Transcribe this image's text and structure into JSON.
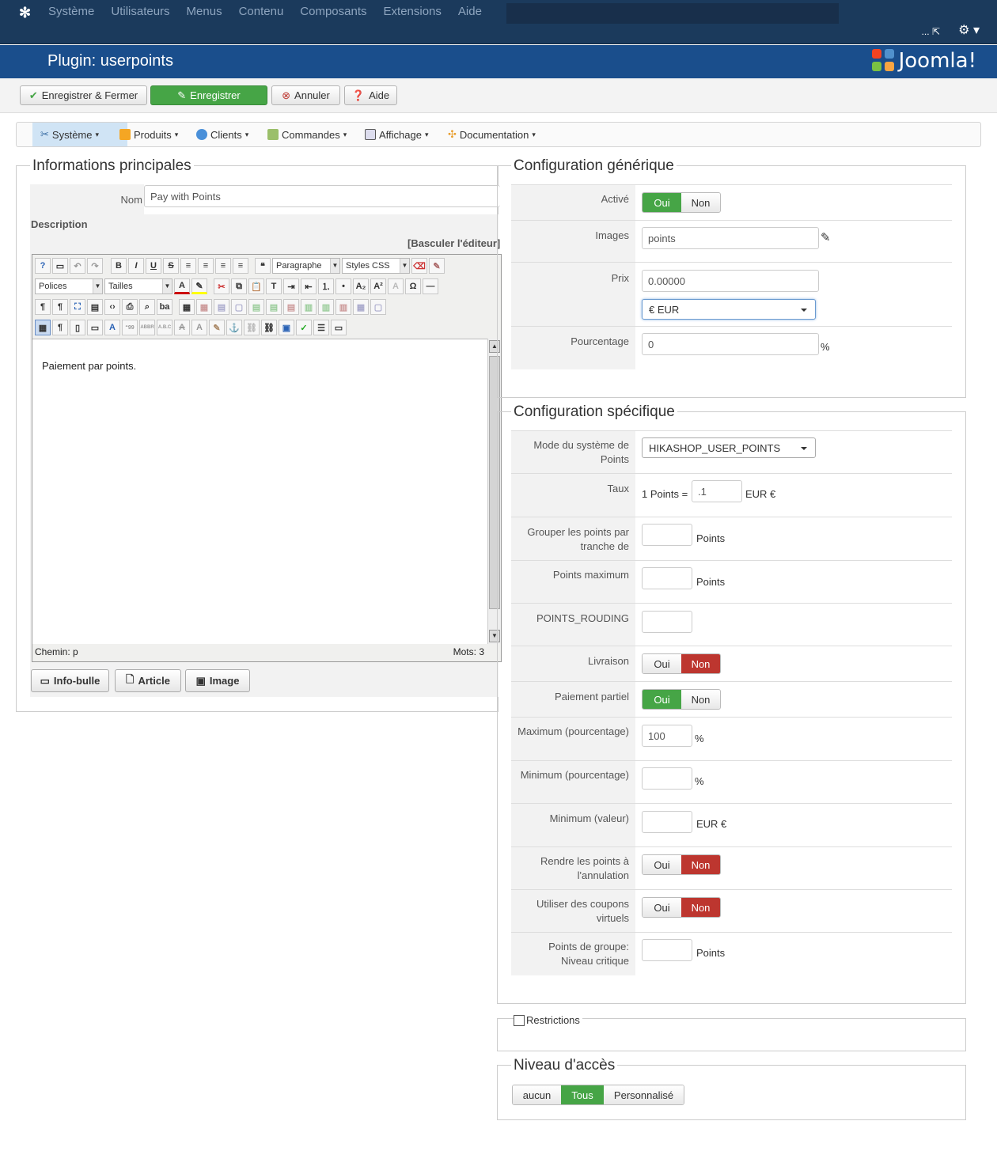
{
  "topbar": {
    "nav": [
      "Système",
      "Utilisateurs",
      "Menus",
      "Contenu",
      "Composants",
      "Extensions",
      "Aide"
    ],
    "right_link": "...",
    "gear_icon": "gear-icon"
  },
  "header": {
    "title": "Plugin: userpoints",
    "brand": "Joomla!"
  },
  "toolbar": {
    "save_close": "Enregistrer & Fermer",
    "save": "Enregistrer",
    "cancel": "Annuler",
    "help": "Aide"
  },
  "menubar": [
    "Système",
    "Produits",
    "Clients",
    "Commandes",
    "Affichage",
    "Documentation"
  ],
  "main_info": {
    "legend": "Informations principales",
    "name_label": "Nom",
    "name_value": "Pay with Points",
    "description_label": "Description",
    "toggle_editor": "[Basculer l'éditeur]",
    "format_select": "Paragraphe",
    "styles_select": "Styles CSS",
    "fonts_select": "Polices",
    "sizes_select": "Tailles",
    "content": "Paiement par points.",
    "path_label": "Chemin:",
    "path_value": "p",
    "words_label": "Mots:",
    "words_value": "3",
    "btn_tooltip": "Info-bulle",
    "btn_article": "Article",
    "btn_image": "Image"
  },
  "generic": {
    "legend": "Configuration générique",
    "active_label": "Activé",
    "images_label": "Images",
    "images_value": "points",
    "price_label": "Prix",
    "price_value": "0.00000",
    "currency": "€ EUR",
    "percent_label": "Pourcentage",
    "percent_value": "0",
    "percent_sign": "%"
  },
  "specific": {
    "legend": "Configuration spécifique",
    "mode_label": "Mode du système de Points",
    "mode_value": "HIKASHOP_USER_POINTS",
    "rate_label": "Taux",
    "rate_prefix": "1 Points =",
    "rate_value": ".1",
    "rate_suffix": "EUR €",
    "group_label": "Grouper les points par tranche de",
    "max_points_label": "Points maximum",
    "rounding_label": "POINTS_ROUDING",
    "shipping_label": "Livraison",
    "partial_label": "Paiement partiel",
    "max_pct_label": "Maximum (pourcentage)",
    "max_pct_value": "100",
    "min_pct_label": "Minimum (pourcentage)",
    "min_val_label": "Minimum (valeur)",
    "refund_label": "Rendre les points à l'annulation",
    "virtual_label": "Utiliser des coupons virtuels",
    "group_points_label": "Points de groupe: Niveau critique",
    "points_unit": "Points",
    "eur_unit": "EUR €"
  },
  "toggles": {
    "yes": "Oui",
    "no": "Non"
  },
  "restrictions": {
    "label": "Restrictions"
  },
  "access": {
    "legend": "Niveau d'accès",
    "options": [
      "aucun",
      "Tous",
      "Personnalisé"
    ]
  },
  "colors": {
    "green": "#46a546",
    "red": "#bd362f",
    "navy": "#1b3a5c",
    "blue": "#1a4e8c"
  }
}
